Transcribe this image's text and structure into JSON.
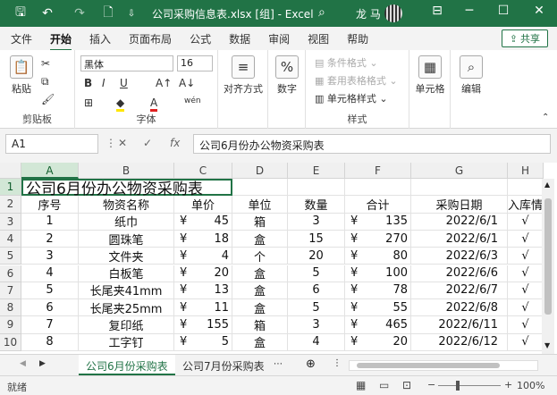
{
  "titlebar": {
    "title": "公司采购信息表.xlsx  [组]  -  Excel",
    "user": "龙 马",
    "search_icon": "search-icon"
  },
  "tabs": [
    "文件",
    "开始",
    "插入",
    "页面布局",
    "公式",
    "数据",
    "审阅",
    "视图",
    "帮助"
  ],
  "active_tab": "开始",
  "share_label": "共享",
  "ribbon": {
    "clipboard": {
      "paste": "粘贴",
      "group": "剪贴板"
    },
    "font": {
      "name": "黑体",
      "size": "16",
      "group": "字体",
      "bold": "B",
      "italic": "I",
      "underline": "U",
      "wen": "wén"
    },
    "align": {
      "label": "对齐方式"
    },
    "number": {
      "label": "数字",
      "icon": "%"
    },
    "styles": {
      "cond": "条件格式",
      "table": "套用表格格式",
      "cell": "单元格样式",
      "group": "样式"
    },
    "cells": {
      "label": "单元格"
    },
    "edit": {
      "label": "编辑"
    }
  },
  "formula_bar": {
    "name_box": "A1",
    "fx": "fx",
    "content": "公司6月份办公物资采购表"
  },
  "columns": [
    "A",
    "B",
    "C",
    "D",
    "E",
    "F",
    "G",
    "H"
  ],
  "rows_hdr": [
    "1",
    "2",
    "3",
    "4",
    "5",
    "6",
    "7",
    "8",
    "9",
    "10"
  ],
  "sheet": {
    "title": "公司6月份办公物资采购表",
    "headers": [
      "序号",
      "物资名称",
      "单价",
      "单位",
      "数量",
      "合计",
      "采购日期",
      "入库情"
    ],
    "rows": [
      [
        "1",
        "纸巾",
        "45",
        "箱",
        "3",
        "135",
        "2022/6/1",
        "√"
      ],
      [
        "2",
        "圆珠笔",
        "18",
        "盒",
        "15",
        "270",
        "2022/6/1",
        "√"
      ],
      [
        "3",
        "文件夹",
        "4",
        "个",
        "20",
        "80",
        "2022/6/3",
        "√"
      ],
      [
        "4",
        "白板笔",
        "20",
        "盒",
        "5",
        "100",
        "2022/6/6",
        "√"
      ],
      [
        "5",
        "长尾夹41mm",
        "13",
        "盒",
        "6",
        "78",
        "2022/6/7",
        "√"
      ],
      [
        "6",
        "长尾夹25mm",
        "11",
        "盒",
        "5",
        "55",
        "2022/6/8",
        "√"
      ],
      [
        "7",
        "复印纸",
        "155",
        "箱",
        "3",
        "465",
        "2022/6/11",
        "√"
      ],
      [
        "8",
        "工字钉",
        "5",
        "盒",
        "4",
        "20",
        "2022/6/12",
        "√"
      ]
    ],
    "currency": "¥"
  },
  "sheet_tabs": [
    "公司6月份采购表",
    "公司7月份采购表"
  ],
  "status": {
    "mode": "就绪",
    "zoom": "100%"
  }
}
